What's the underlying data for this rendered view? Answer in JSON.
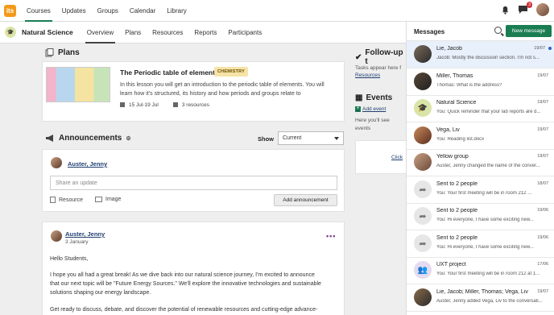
{
  "topbar": {
    "logo": "its",
    "nav": [
      "Courses",
      "Updates",
      "Groups",
      "Calendar",
      "Library"
    ],
    "active": "Courses",
    "message_badge": "3"
  },
  "course": {
    "title": "Natural Science",
    "tabs": [
      "Overview",
      "Plans",
      "Resources",
      "Reports",
      "Participants"
    ],
    "active_tab": "Overview"
  },
  "plans": {
    "heading": "Plans",
    "item": {
      "title": "The Periodic table of elements",
      "tag": "CHEMISTRY",
      "description": "In this lesson you will get an introduction to the periodic table of elements. You will learn how it's structured, its history and how periods and groups relate to",
      "dates": "15 Jul-19 Jul",
      "resources": "3 resources"
    }
  },
  "announcements": {
    "heading": "Announcements",
    "show_label": "Show",
    "show_value": "Current",
    "author": "Auster, Jenny",
    "share_placeholder": "Share an update",
    "resource_label": "Resource",
    "image_label": "Image",
    "add_button": "Add announcement",
    "post": {
      "author": "Auster, Jenny",
      "date": "3 January",
      "greeting": "Hello Students,",
      "para1_l1": "I hope you all had a great break! As we dive back into our natural science journey, I'm excited to announce",
      "para1_l2": "that our next topic will be \"Future Energy Sources.\" We'll explore the innovative technologies and sustainable",
      "para1_l3": "solutions shaping our energy landscape.",
      "para2_l1": "Get ready to discuss, debate, and discover the potential of renewable resources and cutting-edge advance-"
    }
  },
  "right": {
    "followup_heading": "Follow-up t",
    "followup_text": "Tasks appear here f",
    "followup_link": "Resources",
    "events_heading": "Events",
    "add_event": "Add event",
    "events_text": "Here you'll see events",
    "click_text": "Click"
  },
  "messages": {
    "title": "Messages",
    "new_button": "New message",
    "conversations": [
      {
        "name": "Lie, Jacob",
        "date": "19/07",
        "preview": "Jacob: Mostly the discussion section. I'm not s..."
      },
      {
        "name": "Miller, Thomas",
        "date": "19/07",
        "preview": "Thomas: What is the address?"
      },
      {
        "name": "Natural Science",
        "date": "19/07",
        "preview": "You: Quick reminder that your lab reports are d..."
      },
      {
        "name": "Vega, Liv",
        "date": "19/07",
        "preview": "You: Reading list.docx"
      },
      {
        "name": "Yellow group",
        "date": "19/07",
        "preview": "Auster, Jenny changed the name of the conver..."
      },
      {
        "name": "Sent to 2 people",
        "date": "18/07",
        "preview": "You: Your first meeting will be in room 212 ..."
      },
      {
        "name": "Sent to 2 people",
        "date": "19/06",
        "preview": "You: Hi everyone, I have some exciting new..."
      },
      {
        "name": "Sent to 2 people",
        "date": "19/06",
        "preview": "You: Hi everyone, I have some exciting new..."
      },
      {
        "name": "UXT project",
        "date": "17/06",
        "preview": "You: Your first meeting will be in room 212 at 1..."
      },
      {
        "name": "Lie, Jacob; Miller, Thomas; Vega, Liv",
        "date": "19/07",
        "preview": "Auster, Jenny added Vega, Liv to the conversati..."
      }
    ]
  },
  "colors": {
    "accent": "#1a7d52",
    "logo": "#f39a1a",
    "badge": "#d0323a",
    "tag": "#f6e3a7"
  }
}
